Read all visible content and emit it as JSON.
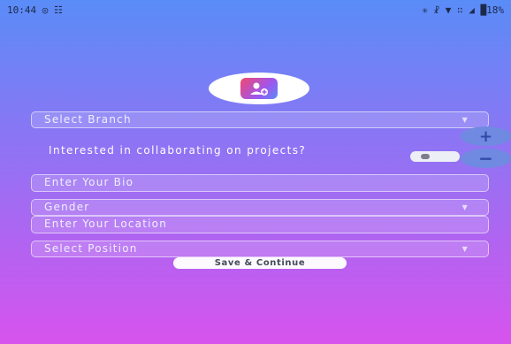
{
  "status_bar": {
    "time": "10:44",
    "left_icons": "◎ ☷",
    "right_icons": "✳ ☧ ▼ ∷ ◢",
    "battery": "█18%"
  },
  "profile": {
    "icon": "add-user-icon"
  },
  "form": {
    "branch_placeholder": "Select Branch",
    "collab_question": "Interested in collaborating on projects?",
    "collab_toggle_on": false,
    "bio_placeholder": "Enter Your Bio",
    "gender_placeholder": "Gender",
    "location_placeholder": "Enter Your Location",
    "position_placeholder": "Select Position",
    "dropdown_caret": "▼",
    "save_label": "Save & Continue"
  },
  "fab": {
    "plus": "+",
    "minus": "−"
  }
}
